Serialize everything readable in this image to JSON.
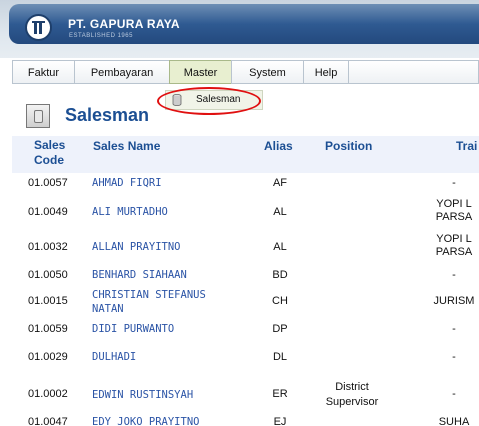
{
  "header": {
    "company_name": "PT. GAPURA RAYA",
    "established": "ESTABLISHED 1965"
  },
  "menu": {
    "items": [
      {
        "label": "Faktur"
      },
      {
        "label": "Pembayaran"
      },
      {
        "label": "Master"
      },
      {
        "label": "System"
      },
      {
        "label": "Help"
      }
    ],
    "active": "Master",
    "dropdown": {
      "label": "Salesman"
    }
  },
  "page": {
    "title": "Salesman"
  },
  "table": {
    "headers": {
      "code_line1": "Sales",
      "code_line2": "Code",
      "name": "Sales Name",
      "alias": "Alias",
      "position": "Position",
      "trainer": "Trai"
    },
    "rows": [
      {
        "code": "01.0057",
        "name_l1": "AHMAD FIQRI",
        "name_l2": "",
        "alias": "AF",
        "pos_l1": "",
        "pos_l2": "",
        "tr_l1": "-",
        "tr_l2": ""
      },
      {
        "code": "01.0049",
        "name_l1": "ALI MURTADHO",
        "name_l2": "",
        "alias": "AL",
        "pos_l1": "",
        "pos_l2": "",
        "tr_l1": "YOPI L",
        "tr_l2": "PARSA"
      },
      {
        "code": "01.0032",
        "name_l1": "ALLAN PRAYITNO",
        "name_l2": "",
        "alias": "AL",
        "pos_l1": "",
        "pos_l2": "",
        "tr_l1": "YOPI L",
        "tr_l2": "PARSA"
      },
      {
        "code": "01.0050",
        "name_l1": "BENHARD SIAHAAN",
        "name_l2": "",
        "alias": "BD",
        "pos_l1": "",
        "pos_l2": "",
        "tr_l1": "-",
        "tr_l2": ""
      },
      {
        "code": "01.0015",
        "name_l1": "CHRISTIAN STEFANUS",
        "name_l2": "NATAN",
        "alias": "CH",
        "pos_l1": "",
        "pos_l2": "",
        "tr_l1": "JURISM",
        "tr_l2": ""
      },
      {
        "code": "01.0059",
        "name_l1": "DIDI PURWANTO",
        "name_l2": "",
        "alias": "DP",
        "pos_l1": "",
        "pos_l2": "",
        "tr_l1": "-",
        "tr_l2": ""
      },
      {
        "code": "01.0029",
        "name_l1": "DULHADI",
        "name_l2": "",
        "alias": "DL",
        "pos_l1": "",
        "pos_l2": "",
        "tr_l1": "-",
        "tr_l2": ""
      },
      {
        "code": "01.0002",
        "name_l1": "EDWIN RUSTINSYAH",
        "name_l2": "",
        "alias": "ER",
        "pos_l1": "District",
        "pos_l2": "Supervisor",
        "tr_l1": "-",
        "tr_l2": ""
      },
      {
        "code": "01.0047",
        "name_l1": "EDY JOKO PRAYITNO",
        "name_l2": "",
        "alias": "EJ",
        "pos_l1": "",
        "pos_l2": "",
        "tr_l1": "SUHA",
        "tr_l2": ""
      }
    ]
  }
}
